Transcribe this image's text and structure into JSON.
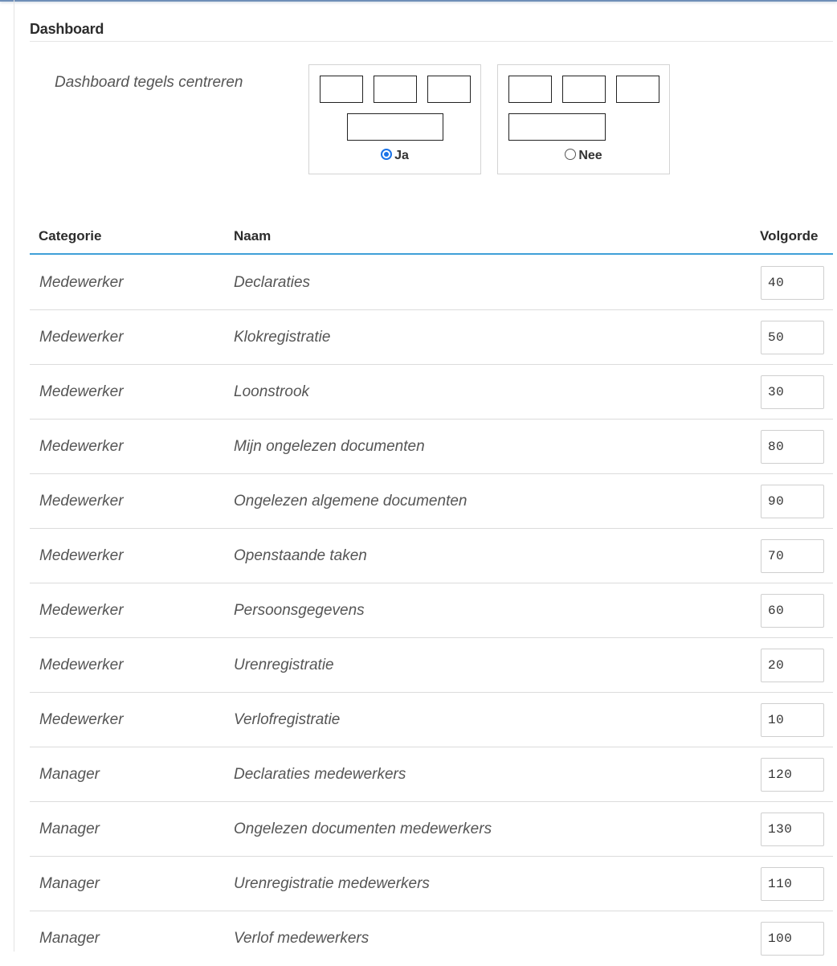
{
  "section": {
    "title": "Dashboard"
  },
  "center_tiles": {
    "label": "Dashboard tegels centreren",
    "options": [
      {
        "label": "Ja",
        "selected": true
      },
      {
        "label": "Nee",
        "selected": false
      }
    ]
  },
  "table": {
    "headers": {
      "category": "Categorie",
      "name": "Naam",
      "order": "Volgorde"
    },
    "rows": [
      {
        "category": "Medewerker",
        "name": "Declaraties",
        "order": "40"
      },
      {
        "category": "Medewerker",
        "name": "Klokregistratie",
        "order": "50"
      },
      {
        "category": "Medewerker",
        "name": "Loonstrook",
        "order": "30"
      },
      {
        "category": "Medewerker",
        "name": "Mijn ongelezen documenten",
        "order": "80"
      },
      {
        "category": "Medewerker",
        "name": "Ongelezen algemene documenten",
        "order": "90"
      },
      {
        "category": "Medewerker",
        "name": "Openstaande taken",
        "order": "70"
      },
      {
        "category": "Medewerker",
        "name": "Persoonsgegevens",
        "order": "60"
      },
      {
        "category": "Medewerker",
        "name": "Urenregistratie",
        "order": "20"
      },
      {
        "category": "Medewerker",
        "name": "Verlofregistratie",
        "order": "10"
      },
      {
        "category": "Manager",
        "name": "Declaraties medewerkers",
        "order": "120"
      },
      {
        "category": "Manager",
        "name": "Ongelezen documenten medewerkers",
        "order": "130"
      },
      {
        "category": "Manager",
        "name": "Urenregistratie medewerkers",
        "order": "110"
      },
      {
        "category": "Manager",
        "name": "Verlof medewerkers",
        "order": "100"
      }
    ]
  },
  "colors": {
    "accent": "#3fa0d8",
    "radio_selected": "#1a73e8"
  }
}
